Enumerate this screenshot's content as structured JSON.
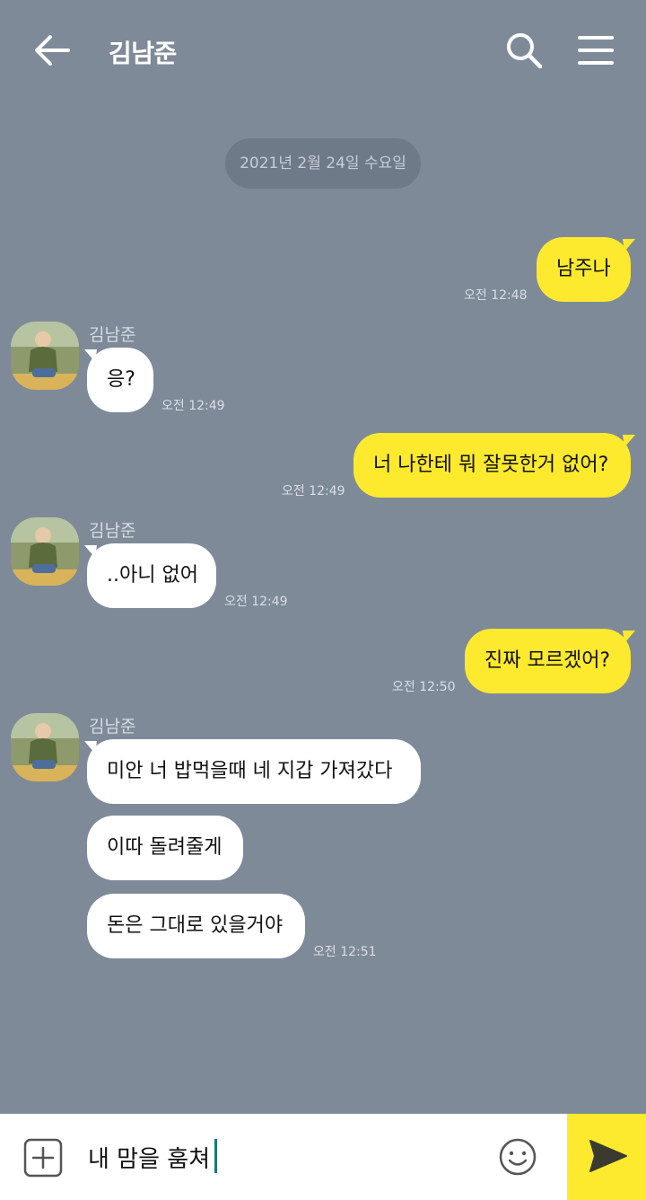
{
  "header": {
    "title": "김남준",
    "back_icon": "arrow-left-icon",
    "search_icon": "search-icon",
    "menu_icon": "hamburger-menu-icon"
  },
  "date_divider": "2021년 2월 24일 수요일",
  "sender_name": "김남준",
  "messages": [
    {
      "from": "me",
      "text": "남주나",
      "time": "오전 12:48"
    },
    {
      "from": "other",
      "text": "응?",
      "time": "오전 12:49"
    },
    {
      "from": "me",
      "text": "너 나한테 뭐 잘못한거 없어?",
      "time": "오전 12:49"
    },
    {
      "from": "other",
      "text": "..아니 없어",
      "time": "오전 12:49"
    },
    {
      "from": "me",
      "text": "진짜 모르겠어?",
      "time": "오전 12:50"
    },
    {
      "from": "other",
      "text": "미안 너 밥먹을때 네 지갑 가져갔다",
      "time": ""
    },
    {
      "from": "other",
      "text": "이따 돌려줄게",
      "time": ""
    },
    {
      "from": "other",
      "text": "돈은 그대로 있을거야",
      "time": "오전 12:51"
    }
  ],
  "input": {
    "value": "내 맘을 훔쳐",
    "plus_icon": "plus-square-icon",
    "emoji_icon": "smiley-icon",
    "send_icon": "send-arrow-icon"
  },
  "colors": {
    "background": "#7f8a99",
    "my_bubble": "#fde92e",
    "other_bubble": "#ffffff",
    "send_button": "#fde92e"
  }
}
